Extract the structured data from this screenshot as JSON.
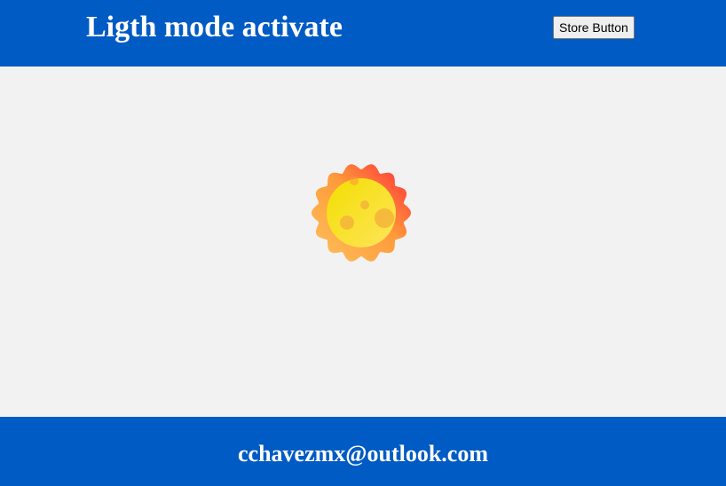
{
  "header": {
    "title": "Ligth mode activate",
    "store_button_label": "Store Button"
  },
  "main": {
    "mode_icon": "sun-icon"
  },
  "footer": {
    "email": "cchavezmx@outlook.com"
  },
  "colors": {
    "bar": "#005bc4",
    "background": "#f2f2f2",
    "text_on_bar": "#ffffff",
    "sun_outer_start": "#ffb347",
    "sun_outer_end": "#ff2d3a",
    "sun_inner_start": "#ffe600",
    "sun_inner_end": "#ffd84a"
  }
}
